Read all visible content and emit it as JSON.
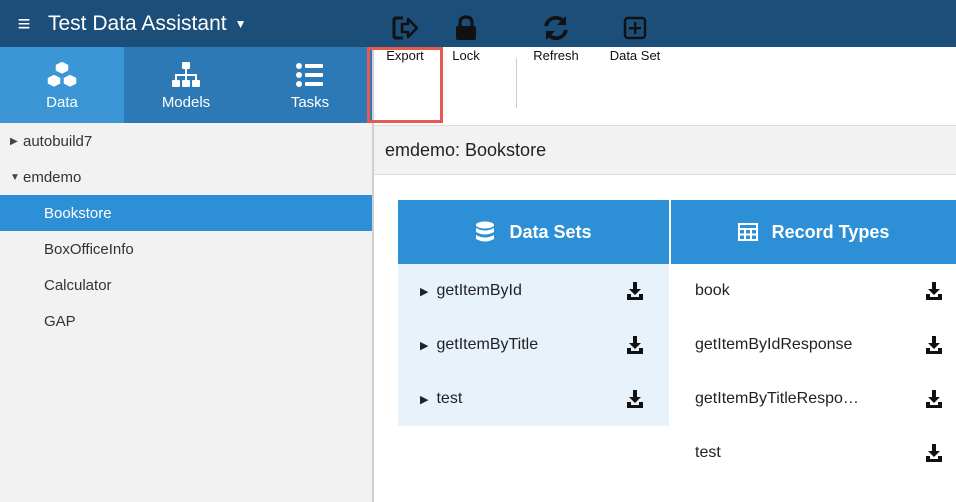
{
  "app": {
    "title": "Test Data Assistant"
  },
  "left_tabs": [
    {
      "label": "Data",
      "icon": "cubes-icon"
    },
    {
      "label": "Models",
      "icon": "sitemap-icon"
    },
    {
      "label": "Tasks",
      "icon": "list-icon"
    }
  ],
  "tree": {
    "roots": [
      {
        "label": "autobuild7",
        "expanded": false
      },
      {
        "label": "emdemo",
        "expanded": true
      }
    ],
    "children": [
      "Bookstore",
      "BoxOfficeInfo",
      "Calculator",
      "GAP"
    ],
    "selected": "Bookstore"
  },
  "toolbar": {
    "export": "Export",
    "lock": "Lock",
    "refresh": "Refresh",
    "dataset": "Data Set"
  },
  "crumb": "emdemo: Bookstore",
  "data_sets": {
    "title": "Data Sets",
    "items": [
      "getItemById",
      "getItemByTitle",
      "test"
    ]
  },
  "record_types": {
    "title": "Record Types",
    "items": [
      "book",
      "getItemByIdResponse",
      "getItemByTitleRespo…",
      "test"
    ]
  },
  "colors": {
    "title_bar": "#1b4f7a",
    "nav_bar": "#2d79b5",
    "accent": "#2d8fd6",
    "highlight": "#e85a50"
  }
}
